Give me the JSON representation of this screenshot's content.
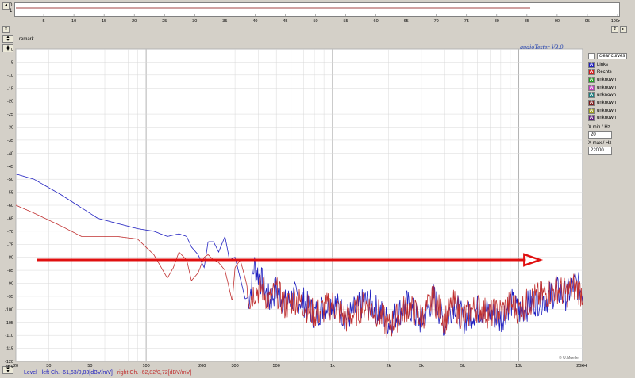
{
  "top_strip": {
    "ylabel_0": "0",
    "ylabel_1": "1",
    "ticks": [
      "5",
      "10",
      "15",
      "20",
      "25",
      "30",
      "35",
      "40",
      "45",
      "50",
      "55",
      "60",
      "65",
      "70",
      "75",
      "80",
      "85",
      "90",
      "95",
      "100ms"
    ]
  },
  "remark_label": "remark",
  "brand": "audioTester  V3.0",
  "copyright": "© U.Mueller",
  "legend": {
    "clear_label": "clear curves",
    "items": [
      {
        "letter": "A",
        "label": "Links",
        "color": "#2020c0"
      },
      {
        "letter": "A",
        "label": "Rechts",
        "color": "#d02020"
      },
      {
        "letter": "A",
        "label": "unknown",
        "color": "#20a020"
      },
      {
        "letter": "A",
        "label": "unknown",
        "color": "#c040c0"
      },
      {
        "letter": "A",
        "label": "unknown",
        "color": "#208080"
      },
      {
        "letter": "A",
        "label": "unknown",
        "color": "#802020"
      },
      {
        "letter": "A",
        "label": "unknown",
        "color": "#a0a020"
      },
      {
        "letter": "A",
        "label": "unknown",
        "color": "#602080"
      }
    ]
  },
  "xmin": {
    "label": "X min / Hz",
    "value": "20"
  },
  "xmax": {
    "label": "X max / Hz",
    "value": "22000"
  },
  "status": {
    "level_label": "Level",
    "left": "left Ch. -61,63/0,83[dBV/mV]",
    "right": "right Ch. -62,82/0,72[dBV/mV]"
  },
  "colors": {
    "left": "#2020c0",
    "right": "#c03030",
    "arrow": "#e01010",
    "grid": "#c8c8c8"
  },
  "chart_data": {
    "type": "line",
    "x_scale": "log",
    "xlim": [
      20,
      22000
    ],
    "ylim": [
      -120,
      0
    ],
    "y_unit": "dBV",
    "yticks": [
      "0",
      "-5",
      "-10",
      "-15",
      "-20",
      "-25",
      "-30",
      "-35",
      "-40",
      "-45",
      "-50",
      "-55",
      "-60",
      "-65",
      "-70",
      "-75",
      "-80",
      "-85",
      "-90",
      "-95",
      "-100",
      "-105",
      "-110",
      "-115",
      "-120"
    ],
    "ytop_label": "dBV",
    "xticks": [
      {
        "v": 20,
        "l": "20"
      },
      {
        "v": 30,
        "l": "30"
      },
      {
        "v": 50,
        "l": "50"
      },
      {
        "v": 100,
        "l": "100"
      },
      {
        "v": 200,
        "l": "200"
      },
      {
        "v": 300,
        "l": "300"
      },
      {
        "v": 500,
        "l": "500"
      },
      {
        "v": 1000,
        "l": "1k"
      },
      {
        "v": 2000,
        "l": "2k"
      },
      {
        "v": 3000,
        "l": "3k"
      },
      {
        "v": 5000,
        "l": "5k"
      },
      {
        "v": 10000,
        "l": "10k"
      },
      {
        "v": 22000,
        "l": "20kHz"
      }
    ],
    "arrow": {
      "x_start": 26,
      "x_end": 13000,
      "y": -81
    },
    "series": [
      {
        "name": "Links",
        "x": [
          20,
          25,
          35,
          45,
          55,
          70,
          90,
          110,
          130,
          150,
          165,
          175,
          190,
          205,
          215,
          230,
          245,
          265,
          280,
          300,
          320,
          340,
          360,
          380,
          420,
          460,
          500,
          560,
          620,
          700,
          800,
          900,
          1000,
          1200,
          1500,
          1800,
          2000,
          2500,
          3000,
          3500,
          4000,
          4500,
          5000,
          6000,
          7000,
          8000,
          9000,
          10000,
          12000,
          14000,
          16000,
          18000,
          20000,
          22000
        ],
        "y": [
          -48,
          -50,
          -56,
          -61,
          -65,
          -67,
          -69,
          -70,
          -72,
          -71,
          -72,
          -76,
          -79,
          -84,
          -74,
          -74,
          -78,
          -72,
          -81,
          -80,
          -88,
          -96,
          -95,
          -83,
          -90,
          -97,
          -92,
          -98,
          -95,
          -97,
          -102,
          -99,
          -97,
          -103,
          -97,
          -101,
          -105,
          -98,
          -105,
          -95,
          -106,
          -97,
          -104,
          -100,
          -101,
          -104,
          -97,
          -101,
          -97,
          -96,
          -93,
          -95,
          -90,
          -93
        ]
      },
      {
        "name": "Rechts",
        "x": [
          20,
          25,
          35,
          45,
          55,
          70,
          90,
          110,
          130,
          140,
          150,
          165,
          175,
          190,
          205,
          215,
          230,
          245,
          265,
          290,
          300,
          320,
          340,
          360,
          380,
          420,
          460,
          500,
          560,
          620,
          700,
          800,
          900,
          1000,
          1200,
          1500,
          1800,
          2000,
          2500,
          3000,
          3500,
          4000,
          4500,
          5000,
          6000,
          7000,
          8000,
          9000,
          10000,
          12000,
          14000,
          16000,
          18000,
          20000,
          22000
        ],
        "y": [
          -60,
          -63,
          -68,
          -72,
          -72,
          -72,
          -73,
          -79,
          -88,
          -84,
          -78,
          -81,
          -89,
          -86,
          -80,
          -79,
          -81,
          -82,
          -85,
          -97,
          -84,
          -81,
          -88,
          -96,
          -93,
          -92,
          -97,
          -93,
          -99,
          -96,
          -98,
          -102,
          -100,
          -98,
          -104,
          -98,
          -102,
          -107,
          -99,
          -103,
          -96,
          -104,
          -98,
          -103,
          -99,
          -102,
          -101,
          -98,
          -100,
          -96,
          -94,
          -92,
          -94,
          -91,
          -94
        ]
      }
    ]
  }
}
